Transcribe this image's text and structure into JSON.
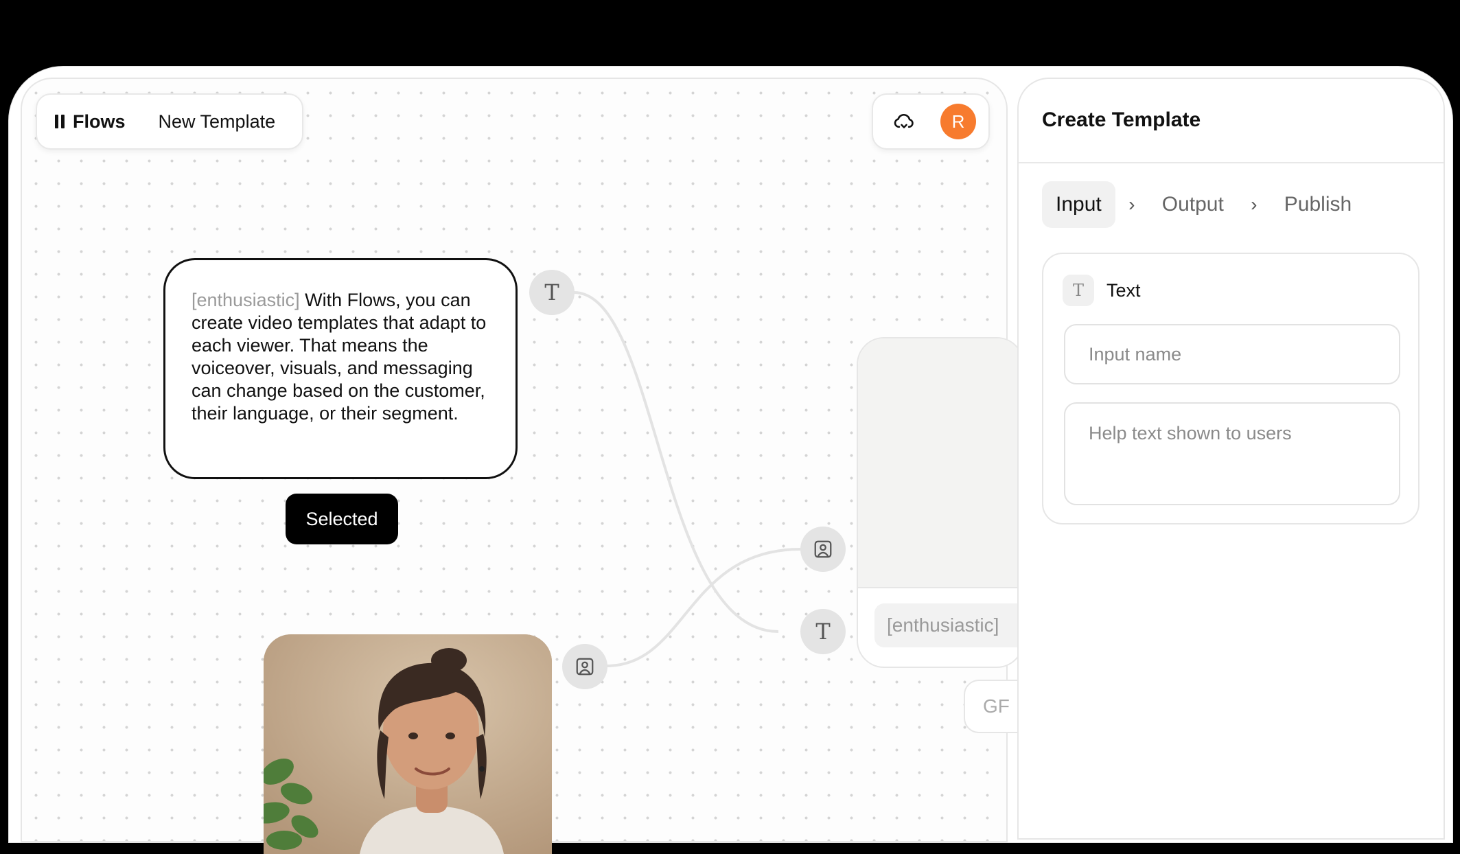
{
  "header": {
    "brand": "Flows",
    "template_name": "New Template",
    "avatar_initial": "R",
    "avatar_color": "#f77b2e"
  },
  "canvas": {
    "text_node": {
      "tag": "[enthusiastic]",
      "body": " With Flows, you can create video templates that adapt to each viewer. That means the voiceover, visuals, and messaging can change based on the customer, their language, or their segment."
    },
    "selected_label": "Selected",
    "output_chip": "[enthusiastic]",
    "gf_chip": "GF"
  },
  "panel": {
    "title": "Create Template",
    "steps": [
      "Input",
      "Output",
      "Publish"
    ],
    "active_step": "Input",
    "card": {
      "type_label": "Text",
      "name_placeholder": "Input name",
      "help_placeholder": "Help text shown to users"
    }
  }
}
